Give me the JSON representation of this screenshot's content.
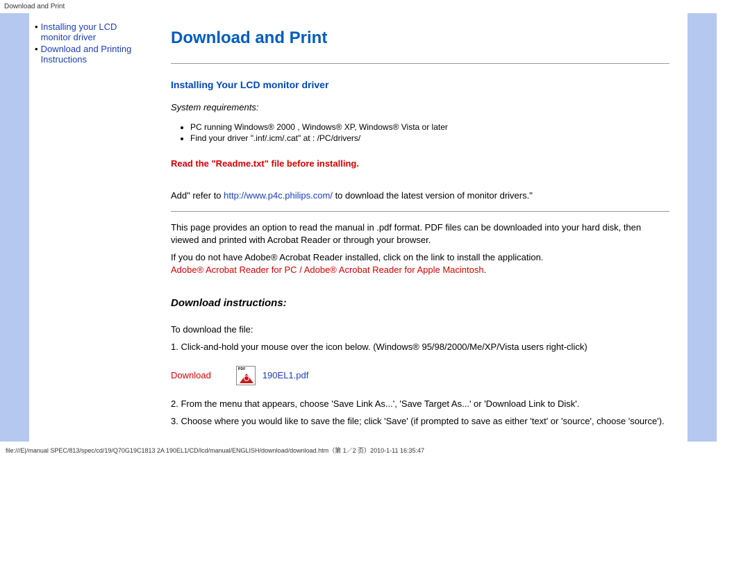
{
  "top_bar": "Download and Print",
  "sidebar": {
    "items": [
      {
        "label": "Installing your LCD monitor driver"
      },
      {
        "label": "Download and Printing Instructions"
      }
    ]
  },
  "main": {
    "title": "Download and Print",
    "section1_heading": "Installing Your LCD monitor driver",
    "system_requirements_label": "System requirements:",
    "reqs": [
      "PC running Windows® 2000 , Windows® XP, Windows® Vista or later",
      "Find your driver \".inf/.icm/.cat\" at : /PC/drivers/"
    ],
    "readme_warning": "Read the \"Readme.txt\" file before installing.",
    "add_refer_pre": "Add\" refer to ",
    "philips_url": "http://www.p4c.philips.com/",
    "add_refer_post": " to download the latest version of monitor drivers.\"",
    "pdf_intro": "This page provides an option to read the manual in .pdf format. PDF files can be downloaded into your hard disk, then viewed and printed with Acrobat Reader or through your browser.",
    "acrobat_pre": "If you do not have Adobe® Acrobat Reader installed, click on the link to install the application.",
    "acrobat_pc": "Adobe® Acrobat Reader for PC",
    "acrobat_sep": " / ",
    "acrobat_mac": "Adobe® Acrobat Reader for Apple Macintosh",
    "acrobat_end": ".",
    "download_instructions_heading": "Download instructions:",
    "to_download": "To download the file:",
    "step1": "1. Click-and-hold your mouse over the icon below. (Windows® 95/98/2000/Me/XP/Vista users right-click)",
    "download_label": "Download",
    "pdf_name": "190EL1.pdf",
    "step2": "2. From the menu that appears, choose 'Save Link As...', 'Save Target As...' or 'Download Link to Disk'.",
    "step3": "3. Choose where you would like to save the file; click 'Save' (if prompted to save as either 'text' or 'source', choose 'source')."
  },
  "footer": "file:///E|/manual SPEC/813/spec/cd/19/Q70G19C1813 2A 190EL1/CD/lcd/manual/ENGLISH/download/download.htm（第 1／2 页）2010-1-11 16:35:47"
}
